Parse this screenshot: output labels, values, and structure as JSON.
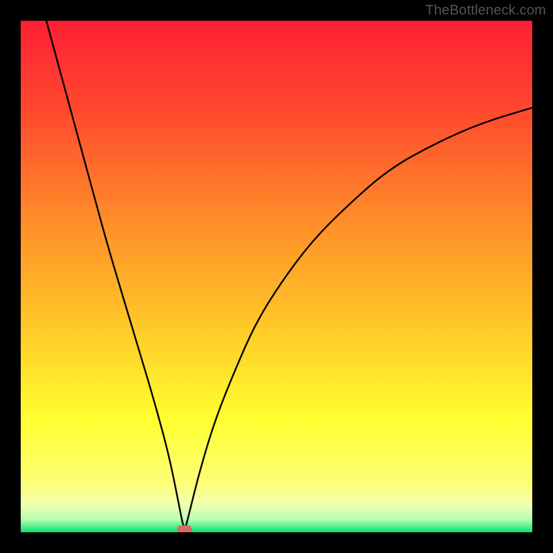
{
  "watermark": "TheBottleneck.com",
  "chart_data": {
    "type": "line",
    "title": "",
    "xlabel": "",
    "ylabel": "",
    "xlim": [
      0,
      100
    ],
    "ylim": [
      0,
      100
    ],
    "minimum_x": 32,
    "curve": {
      "name": "bottleneck-curve",
      "x": [
        5,
        8,
        11,
        14,
        17,
        20,
        23,
        26,
        29,
        31,
        32,
        33,
        35,
        38,
        42,
        46,
        51,
        57,
        64,
        72,
        81,
        90,
        100
      ],
      "y": [
        100,
        89,
        78,
        67,
        56,
        46,
        36,
        26,
        15,
        5,
        0,
        4,
        12,
        22,
        32,
        41,
        49,
        57,
        64,
        71,
        76,
        80,
        83
      ]
    },
    "marker": {
      "x": 32,
      "y": 0,
      "color": "#d96a63"
    },
    "gradient_stops": [
      {
        "offset": 0.0,
        "color": "#ff1f35"
      },
      {
        "offset": 0.18,
        "color": "#ff4a2e"
      },
      {
        "offset": 0.38,
        "color": "#ff8a2a"
      },
      {
        "offset": 0.58,
        "color": "#ffc327"
      },
      {
        "offset": 0.78,
        "color": "#ffff30"
      },
      {
        "offset": 0.905,
        "color": "#fdff78"
      },
      {
        "offset": 0.945,
        "color": "#f1ffb0"
      },
      {
        "offset": 0.975,
        "color": "#b8ffb0"
      },
      {
        "offset": 1.0,
        "color": "#00e571"
      }
    ]
  }
}
